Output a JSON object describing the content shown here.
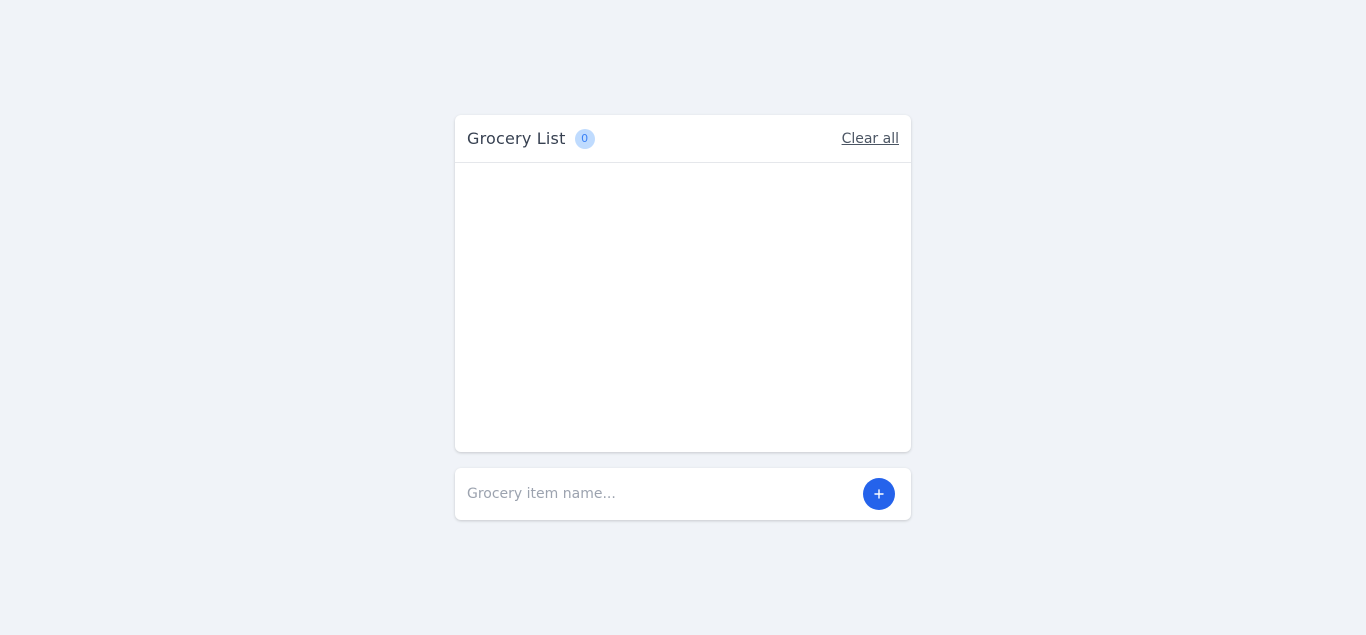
{
  "list": {
    "title": "Grocery List",
    "count": "0",
    "clear_label": "Clear all",
    "items": []
  },
  "input": {
    "placeholder": "Grocery item name...",
    "value": "",
    "add_icon": "plus-icon"
  },
  "colors": {
    "background": "#f0f3f8",
    "accent": "#2563eb",
    "badge_bg": "#bfdbfe",
    "badge_text": "#3b82f6"
  }
}
